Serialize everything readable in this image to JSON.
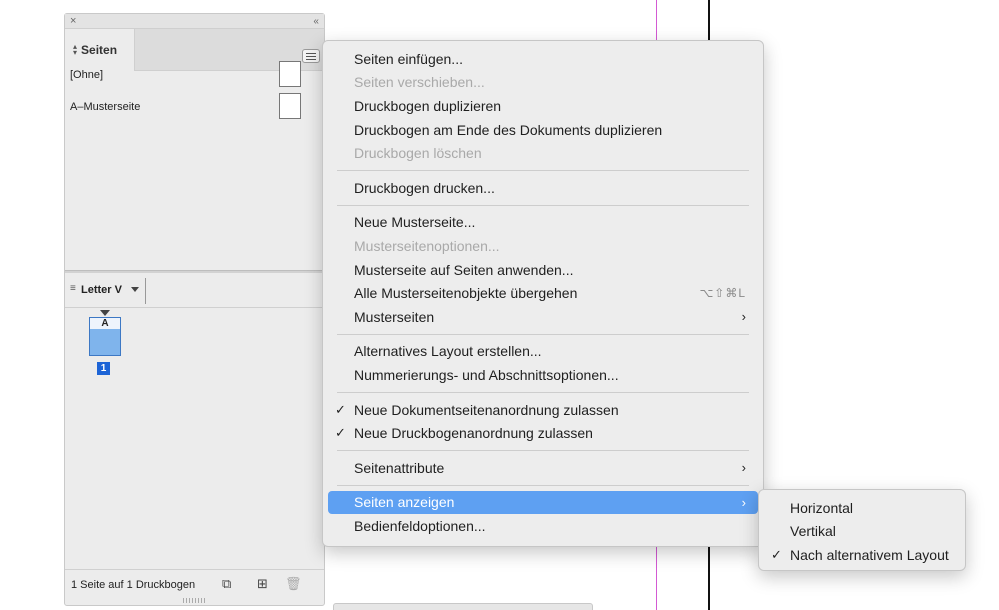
{
  "panel": {
    "tab_label": "Seiten",
    "masters": [
      {
        "label": "[Ohne]"
      },
      {
        "label": "A–Musterseite"
      }
    ],
    "layout_name": "Letter V",
    "page_master_letter": "A",
    "page_number": "1",
    "status_text": "1 Seite auf 1 Druckbogen"
  },
  "menu": {
    "items": [
      {
        "label": "Seiten einfügen...",
        "disabled": false
      },
      {
        "label": "Seiten verschieben...",
        "disabled": true
      },
      {
        "label": "Druckbogen duplizieren",
        "disabled": false
      },
      {
        "label": "Druckbogen am Ende des Dokuments duplizieren",
        "disabled": false
      },
      {
        "label": "Druckbogen löschen",
        "disabled": true
      },
      {
        "label": "Druckbogen drucken...",
        "disabled": false
      },
      {
        "label": "Neue Musterseite...",
        "disabled": false
      },
      {
        "label": "Musterseitenoptionen...",
        "disabled": true
      },
      {
        "label": "Musterseite auf Seiten anwenden...",
        "disabled": false
      },
      {
        "label": "Alle Musterseitenobjekte übergehen",
        "disabled": false,
        "shortcut": "⌥⇧⌘L"
      },
      {
        "label": "Musterseiten",
        "disabled": false
      },
      {
        "label": "Alternatives Layout erstellen...",
        "disabled": false
      },
      {
        "label": "Nummerierungs- und Abschnittsoptionen...",
        "disabled": false
      },
      {
        "label": "Neue Dokumentseitenanordnung zulassen",
        "checked": true
      },
      {
        "label": "Neue Druckbogenanordnung zulassen",
        "checked": true
      },
      {
        "label": "Seitenattribute",
        "disabled": false
      },
      {
        "label": "Seiten anzeigen",
        "disabled": false,
        "highlighted": true
      },
      {
        "label": "Bedienfeldoptionen...",
        "disabled": false
      }
    ],
    "highlight_color": "#5ea0f2"
  },
  "submenu": {
    "items": [
      {
        "label": "Horizontal",
        "checked": false
      },
      {
        "label": "Vertikal",
        "checked": false
      },
      {
        "label": "Nach alternativem Layout",
        "checked": true
      }
    ]
  },
  "glyphs": {
    "check": "✓",
    "arrow": "›"
  }
}
